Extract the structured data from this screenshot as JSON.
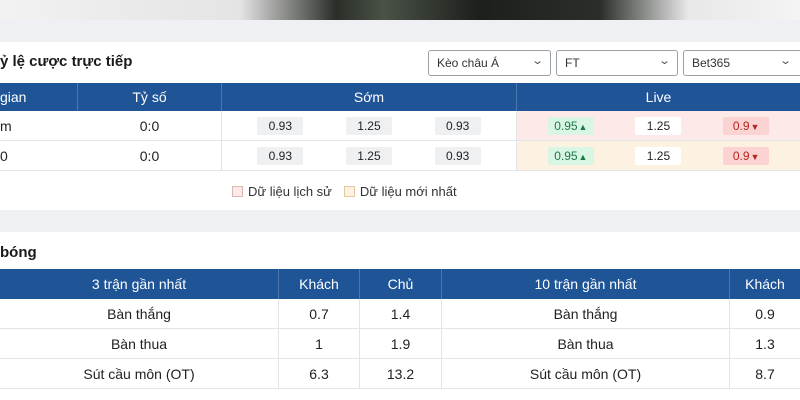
{
  "odds_section": {
    "title": "ỷ lệ cược trực tiếp",
    "selects": [
      {
        "value": "Kèo châu Á"
      },
      {
        "value": "FT"
      },
      {
        "value": "Bet365"
      }
    ],
    "headers": {
      "time": "gian",
      "score": "Tỷ số",
      "early": "Sớm",
      "live": "Live"
    },
    "rows": [
      {
        "time": "m",
        "score": "0:0",
        "early": [
          "0.93",
          "1.25",
          "0.93"
        ],
        "live": [
          "0.95",
          "1.25",
          "0.9"
        ]
      },
      {
        "time": "0",
        "score": "0:0",
        "early": [
          "0.93",
          "1.25",
          "0.93"
        ],
        "live": [
          "0.95",
          "1.25",
          "0.9"
        ]
      }
    ],
    "legend": {
      "history": "Dữ liệu lịch sử",
      "latest": "Dữ liệu mới nhất"
    }
  },
  "stats_section": {
    "title": "bóng",
    "headers": [
      "3 trận gần nhất",
      "Khách",
      "Chủ",
      "10 trận gần nhất",
      "Khách"
    ],
    "rows": [
      [
        "Bàn thắng",
        "0.7",
        "1.4",
        "Bàn thắng",
        "0.9"
      ],
      [
        "Bàn thua",
        "1",
        "1.9",
        "Bàn thua",
        "1.3"
      ],
      [
        "Sút cầu môn (OT)",
        "6.3",
        "13.2",
        "Sút cầu môn (OT)",
        "8.7"
      ]
    ]
  },
  "icons": {
    "chevron": "chevron-down-icon",
    "up": "arrow-up-icon",
    "down": "arrow-down-icon"
  },
  "colors": {
    "header_blue": "#1f5597",
    "up_green": "#1d7a45",
    "down_red": "#b3261e"
  }
}
